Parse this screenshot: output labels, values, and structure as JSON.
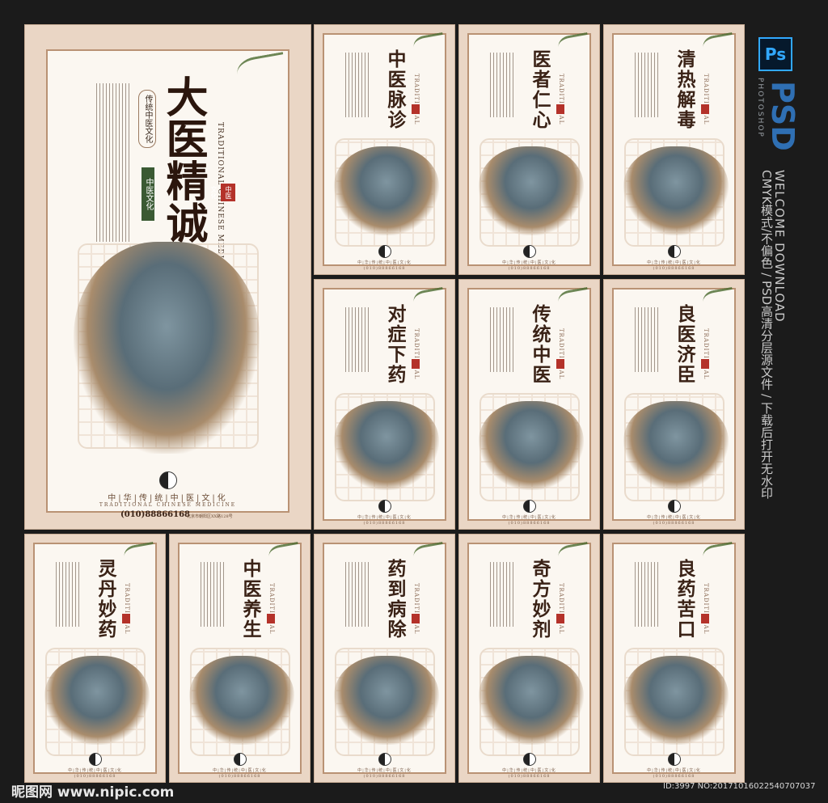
{
  "main_poster": {
    "title": "大医精诚",
    "badge_top": "传统中医文化",
    "badge_bottom": "中医文化",
    "seal": "中医文化",
    "english": "TRADITIONAL CHINESE MEDICINE",
    "footer_title": "中|华|传|统|中|医|文|化",
    "footer_en": "TRADITIONAL CHINESE MEDICINE",
    "phone": "(010)88866168",
    "address": "北京市朝阳区XX路128号"
  },
  "small_posters": [
    {
      "title": "中医脉诊"
    },
    {
      "title": "医者仁心"
    },
    {
      "title": "清热解毒"
    },
    {
      "title": "对症下药"
    },
    {
      "title": "传统中医"
    },
    {
      "title": "良医济臣"
    },
    {
      "title": "灵丹妙药"
    },
    {
      "title": "中医养生"
    },
    {
      "title": "药到病除"
    },
    {
      "title": "奇方妙剂"
    },
    {
      "title": "良药苦口"
    }
  ],
  "small_footer": "中|华|传|统|中|医|文|化",
  "small_phone": "(010)88866168",
  "right_strip": {
    "app_icon": "Ps",
    "psd": "PSD",
    "brand": "PHOTOSHOP",
    "welcome": "WELCOME DOWNLOAD",
    "desc": "CMYK模式/不偏色 / PSD高清分层源文件 / 下载后打开无水印"
  },
  "watermark_left": "昵图网 www.nipic.com",
  "watermark_right": "ID:3997 NO:20171016022540707037"
}
